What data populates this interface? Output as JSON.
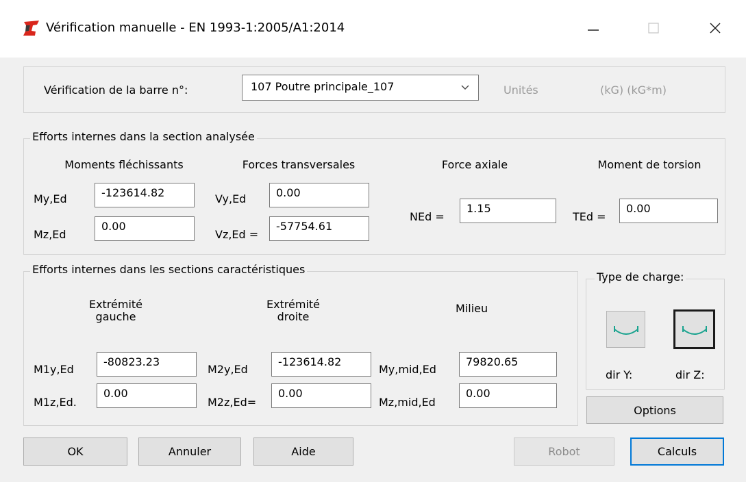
{
  "window": {
    "title": "Vérification manuelle - EN 1993-1:2005/A1:2014",
    "icon": "robot-app-icon",
    "minimize_icon": "minimize-icon",
    "maximize_icon": "maximize-icon",
    "close_icon": "close-icon"
  },
  "bar_selection": {
    "label": "Vérification de la barre n°:",
    "selected": "107  Poutre principale_107",
    "units_label": "Unités",
    "units_value": "(kG) (kG*m)"
  },
  "internal_forces": {
    "group_title": "Efforts internes dans la section analysée",
    "moments_header": "Moments fléchissants",
    "shear_header": "Forces transversales",
    "axial_header": "Force axiale",
    "torsion_header": "Moment de torsion",
    "my_label": "My,Ed",
    "my_value": "-123614.82",
    "mz_label": "Mz,Ed",
    "mz_value": "0.00",
    "vy_label": "Vy,Ed",
    "vy_value": "0.00",
    "vz_label": "Vz,Ed =",
    "vz_value": "-57754.61",
    "ned_label": "NEd =",
    "ned_value": "1.15",
    "ted_label": "TEd =",
    "ted_value": "0.00"
  },
  "char_sections": {
    "group_title": "Efforts internes dans les sections caractéristiques",
    "left_header_1": "Extrémité",
    "left_header_2": "gauche",
    "right_header_1": "Extrémité",
    "right_header_2": "droite",
    "mid_header": "Milieu",
    "m1y_label": "M1y,Ed",
    "m1y_value": "-80823.23",
    "m1z_label": "M1z,Ed.",
    "m1z_value": "0.00",
    "m2y_label": "M2y,Ed",
    "m2y_value": "-123614.82",
    "m2z_label": "M2z,Ed=",
    "m2z_value": "0.00",
    "mymid_label": "My,mid,Ed",
    "mymid_value": "79820.65",
    "mzmid_label": "Mz,mid,Ed",
    "mzmid_value": "0.00"
  },
  "load_type": {
    "group_title": "Type de charge:",
    "dir_y_label": "dir Y:",
    "dir_z_label": "dir Z:",
    "load_icon": "distributed-load-icon",
    "options_label": "Options"
  },
  "buttons": {
    "ok": "OK",
    "cancel": "Annuler",
    "help": "Aide",
    "robot": "Robot",
    "calcs": "Calculs"
  },
  "colors": {
    "load_curve": "#1aa38f",
    "default_button_border": "#0078d7",
    "icon_red": "#d9261c"
  }
}
